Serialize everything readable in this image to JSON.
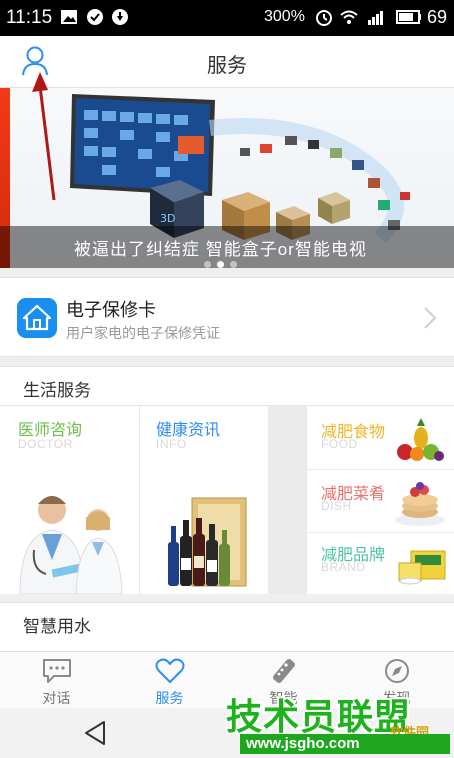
{
  "status_bar": {
    "time": "11:15",
    "network_speed": "300%",
    "battery_level": "69",
    "icons": [
      "image-icon",
      "check-circle-icon",
      "download-icon",
      "alarm-icon",
      "wifi-icon",
      "signal-3g-icon",
      "battery-icon"
    ]
  },
  "header": {
    "title": "服务",
    "user_icon": "user-icon"
  },
  "banner": {
    "caption": "被逼出了纠结症 智能盒子or智能电视",
    "slide_count": 3,
    "active_slide": 2
  },
  "warranty_card": {
    "title": "电子保修卡",
    "subtitle": "用户家电的电子保修凭证",
    "icon": "house-icon"
  },
  "life_services": {
    "title": "生活服务",
    "items": [
      {
        "title": "医师咨询",
        "subtitle": "DOCTOR",
        "color": "#6cc04a",
        "image": "doctors-image"
      },
      {
        "title": "健康资讯",
        "subtitle": "INFO",
        "color": "#2d8ef0",
        "image": "wine-bottles-image"
      },
      {
        "title": "减肥食物",
        "subtitle": "FOOD",
        "color": "#f0b62b",
        "image": "fruit-image"
      },
      {
        "title": "减肥菜肴",
        "subtitle": "DISH",
        "color": "#e8746c",
        "image": "pancake-image"
      },
      {
        "title": "减肥品牌",
        "subtitle": "BRAND",
        "color": "#4fc3a8",
        "image": "product-box-image"
      }
    ]
  },
  "smart_water": {
    "title": "智慧用水"
  },
  "bottom_nav": {
    "active": "服务",
    "items": [
      {
        "label": "对话",
        "icon": "chat-bubble-icon"
      },
      {
        "label": "服务",
        "icon": "heart-icon"
      },
      {
        "label": "智能",
        "icon": "remote-control-icon"
      },
      {
        "label": "发现",
        "icon": "compass-icon"
      }
    ]
  },
  "watermark": {
    "text": "技术员联盟",
    "url": "www.jsgho.com",
    "soft_text": "软件园"
  },
  "colors": {
    "accent": "#2d8ef0",
    "header_bg": "#ffffff",
    "page_bg": "#efefef",
    "annotation_arrow": "#b01818"
  }
}
